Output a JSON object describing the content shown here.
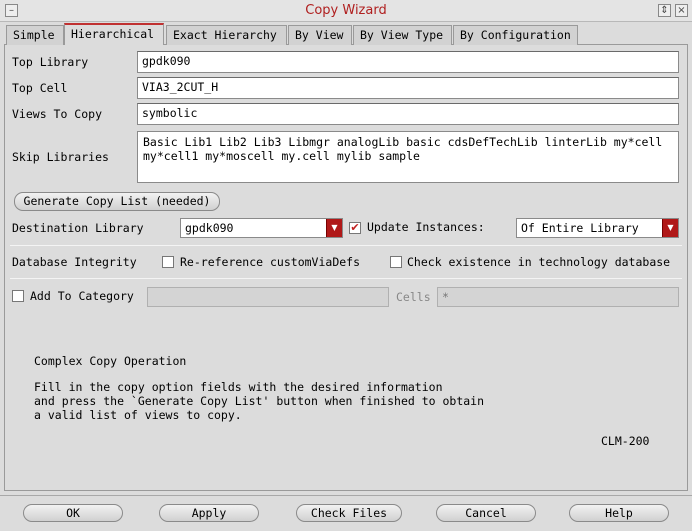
{
  "window": {
    "title": "Copy Wizard"
  },
  "tabs": [
    {
      "label": "Simple"
    },
    {
      "label": "Hierarchical"
    },
    {
      "label": "Exact Hierarchy"
    },
    {
      "label": "By View"
    },
    {
      "label": "By View Type"
    },
    {
      "label": "By Configuration"
    }
  ],
  "form": {
    "top_library": {
      "label": "Top Library",
      "value": "gpdk090"
    },
    "top_cell": {
      "label": "Top Cell",
      "value": "VIA3_2CUT_H"
    },
    "views_to_copy": {
      "label": "Views To Copy",
      "value": "symbolic"
    },
    "skip_libraries": {
      "label": "Skip Libraries",
      "value": "Basic Lib1 Lib2 Lib3 Libmgr analogLib basic cdsDefTechLib linterLib my*cell my*cell1 my*moscell my.cell mylib sample"
    },
    "generate_button": "Generate Copy List (needed)",
    "destination_library": {
      "label": "Destination Library",
      "value": "gpdk090"
    },
    "update_instances": {
      "label": "Update Instances:",
      "checked": true,
      "value": "Of Entire Library"
    },
    "database_integrity": {
      "label": "Database Integrity"
    },
    "rereference": {
      "label": "Re-reference customViaDefs",
      "checked": false
    },
    "check_existence": {
      "label": "Check existence in technology database",
      "checked": false
    },
    "add_to_category": {
      "label": "Add To Category",
      "checked": false,
      "value": ""
    },
    "cells": {
      "label": "Cells",
      "value": "*"
    }
  },
  "message": {
    "heading": "Complex Copy Operation",
    "body": "Fill in the copy option fields with the desired information\nand press the `Generate Copy List' button when finished to obtain\na valid list of views to copy.",
    "code": "CLM-200"
  },
  "footer": {
    "ok": "OK",
    "apply": "Apply",
    "check_files": "Check Files",
    "cancel": "Cancel",
    "help": "Help"
  },
  "colors": {
    "accent": "#b01818",
    "title": "#b02020",
    "background": "#dcdcdc"
  }
}
